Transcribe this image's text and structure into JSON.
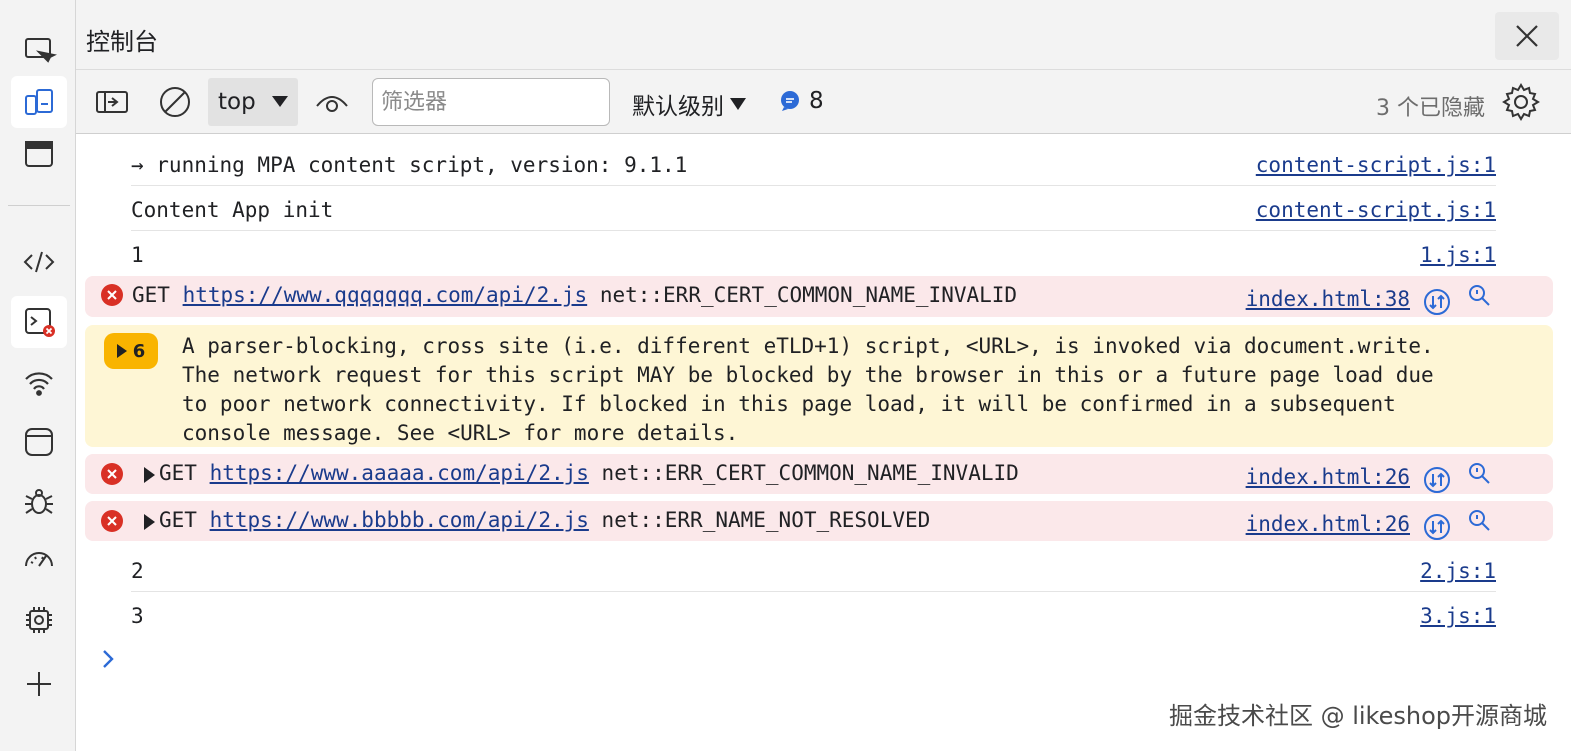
{
  "panel": {
    "title": "控制台"
  },
  "toolbar": {
    "context": "top",
    "filter_placeholder": "筛选器",
    "level_label": "默认级别",
    "message_count": "8",
    "hidden_count": "3 个已隐藏"
  },
  "activity_bar": {
    "items": [
      "inspect-icon",
      "device-emulation-icon",
      "welcome-icon",
      "elements-icon",
      "console-icon",
      "network-icon",
      "application-icon",
      "sources-bug-icon",
      "performance-icon",
      "memory-chip-icon",
      "add-tool-icon"
    ],
    "active": "console-icon"
  },
  "console": {
    "rows": [
      {
        "message": "→ running MPA content script, version: 9.1.1",
        "source": "content-script.js:1"
      },
      {
        "message": "Content App init",
        "source": "content-script.js:1"
      },
      {
        "message": "1",
        "source": "1.js:1"
      }
    ],
    "errors": [
      {
        "method": "GET",
        "url": "https://www.qqqqqqq.com/api/2.js",
        "error": "net::ERR_CERT_COMMON_NAME_INVALID",
        "source": "index.html:38"
      },
      {
        "method": "GET",
        "url": "https://www.aaaaa.com/api/2.js",
        "error": "net::ERR_CERT_COMMON_NAME_INVALID",
        "source": "index.html:26"
      },
      {
        "method": "GET",
        "url": "https://www.bbbbb.com/api/2.js",
        "error": "net::ERR_NAME_NOT_RESOLVED",
        "source": "index.html:26"
      }
    ],
    "warning": {
      "count": "6",
      "lines": [
        "A parser-blocking, cross site (i.e. different eTLD+1) script, <URL>, is invoked via document.write.",
        "The network request for this script MAY be blocked by the browser in this or a future page load due",
        "to poor network connectivity. If blocked in this page load, it will be confirmed in a subsequent",
        "console message. See <URL> for more details."
      ]
    },
    "tail_rows": [
      {
        "message": "2",
        "source": "2.js:1"
      },
      {
        "message": "3",
        "source": "3.js:1"
      }
    ]
  },
  "watermark": "掘金技术社区 @ likeshop开源商城",
  "colors": {
    "error_bg": "#fbe8ea",
    "warning_bg": "#fef6d5",
    "badge": "#f9b400",
    "link": "#1a3b8c",
    "accent": "#2c6ad6",
    "error_icon": "#d93025"
  }
}
